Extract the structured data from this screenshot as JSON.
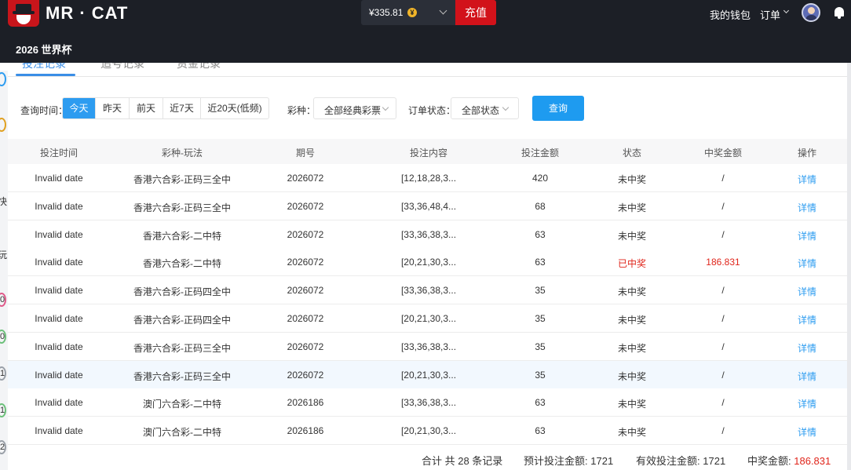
{
  "header": {
    "brand": "MR · CAT",
    "balance": "¥335.81",
    "coin_symbol": "¥",
    "recharge_label": "充值",
    "wallet_label": "我的钱包",
    "orders_label": "订单",
    "section_title": "2026 世界杯"
  },
  "tabs": [
    "投注记录",
    "追号记录",
    "资金记录"
  ],
  "filters": {
    "time_label": "查询时间：",
    "time_options": [
      "今天",
      "昨天",
      "前天",
      "近7天",
      "近20天(低频)"
    ],
    "lottery_label": "彩种：",
    "lottery_value": "全部经典彩票",
    "status_label": "订单状态：",
    "status_value": "全部状态",
    "query_label": "查询"
  },
  "table": {
    "columns": [
      "投注时间",
      "彩种-玩法",
      "期号",
      "投注内容",
      "投注金额",
      "状态",
      "中奖金额",
      "操作"
    ],
    "rows": [
      [
        "Invalid date",
        "香港六合彩-正码三全中",
        "2026072",
        "[12,18,28,3...",
        "420",
        "未中奖",
        "/",
        "详情"
      ],
      [
        "Invalid date",
        "香港六合彩-正码三全中",
        "2026072",
        "[33,36,48,4...",
        "68",
        "未中奖",
        "/",
        "详情"
      ],
      [
        "Invalid date",
        "香港六合彩-二中特",
        "2026072",
        "[33,36,38,3...",
        "63",
        "未中奖",
        "/",
        "详情"
      ],
      [
        "Invalid date",
        "香港六合彩-二中特",
        "2026072",
        "[20,21,30,3...",
        "63",
        "已中奖",
        "186.831",
        "详情"
      ],
      [
        "Invalid date",
        "香港六合彩-正码四全中",
        "2026072",
        "[33,36,38,3...",
        "35",
        "未中奖",
        "/",
        "详情"
      ],
      [
        "Invalid date",
        "香港六合彩-正码四全中",
        "2026072",
        "[20,21,30,3...",
        "35",
        "未中奖",
        "/",
        "详情"
      ],
      [
        "Invalid date",
        "香港六合彩-正码三全中",
        "2026072",
        "[33,36,38,3...",
        "35",
        "未中奖",
        "/",
        "详情"
      ],
      [
        "Invalid date",
        "香港六合彩-正码三全中",
        "2026072",
        "[20,21,30,3...",
        "35",
        "未中奖",
        "/",
        "详情"
      ],
      [
        "Invalid date",
        "澳门六合彩-二中特",
        "2026186",
        "[33,36,38,3...",
        "63",
        "未中奖",
        "/",
        "详情"
      ],
      [
        "Invalid date",
        "澳门六合彩-二中特",
        "2026186",
        "[20,21,30,3...",
        "63",
        "未中奖",
        "/",
        "详情"
      ]
    ],
    "highlighted_row_index": 7,
    "win_status": "已中奖"
  },
  "summary": {
    "total_text": "合计 共 28 条记录",
    "expected_label": "预计投注金额:",
    "expected_value": "1721",
    "valid_label": "有效投注金额:",
    "valid_value": "1721",
    "win_label": "中奖金额:",
    "win_value": "186.831"
  },
  "left_peek": [
    "快",
    "玩",
    "0",
    "0",
    "1",
    "1",
    "2"
  ],
  "colors": {
    "accent": "#2d9cf0",
    "recharge": "#d2121a",
    "win": "#e0251b",
    "header_bg": "#1c1f26"
  }
}
